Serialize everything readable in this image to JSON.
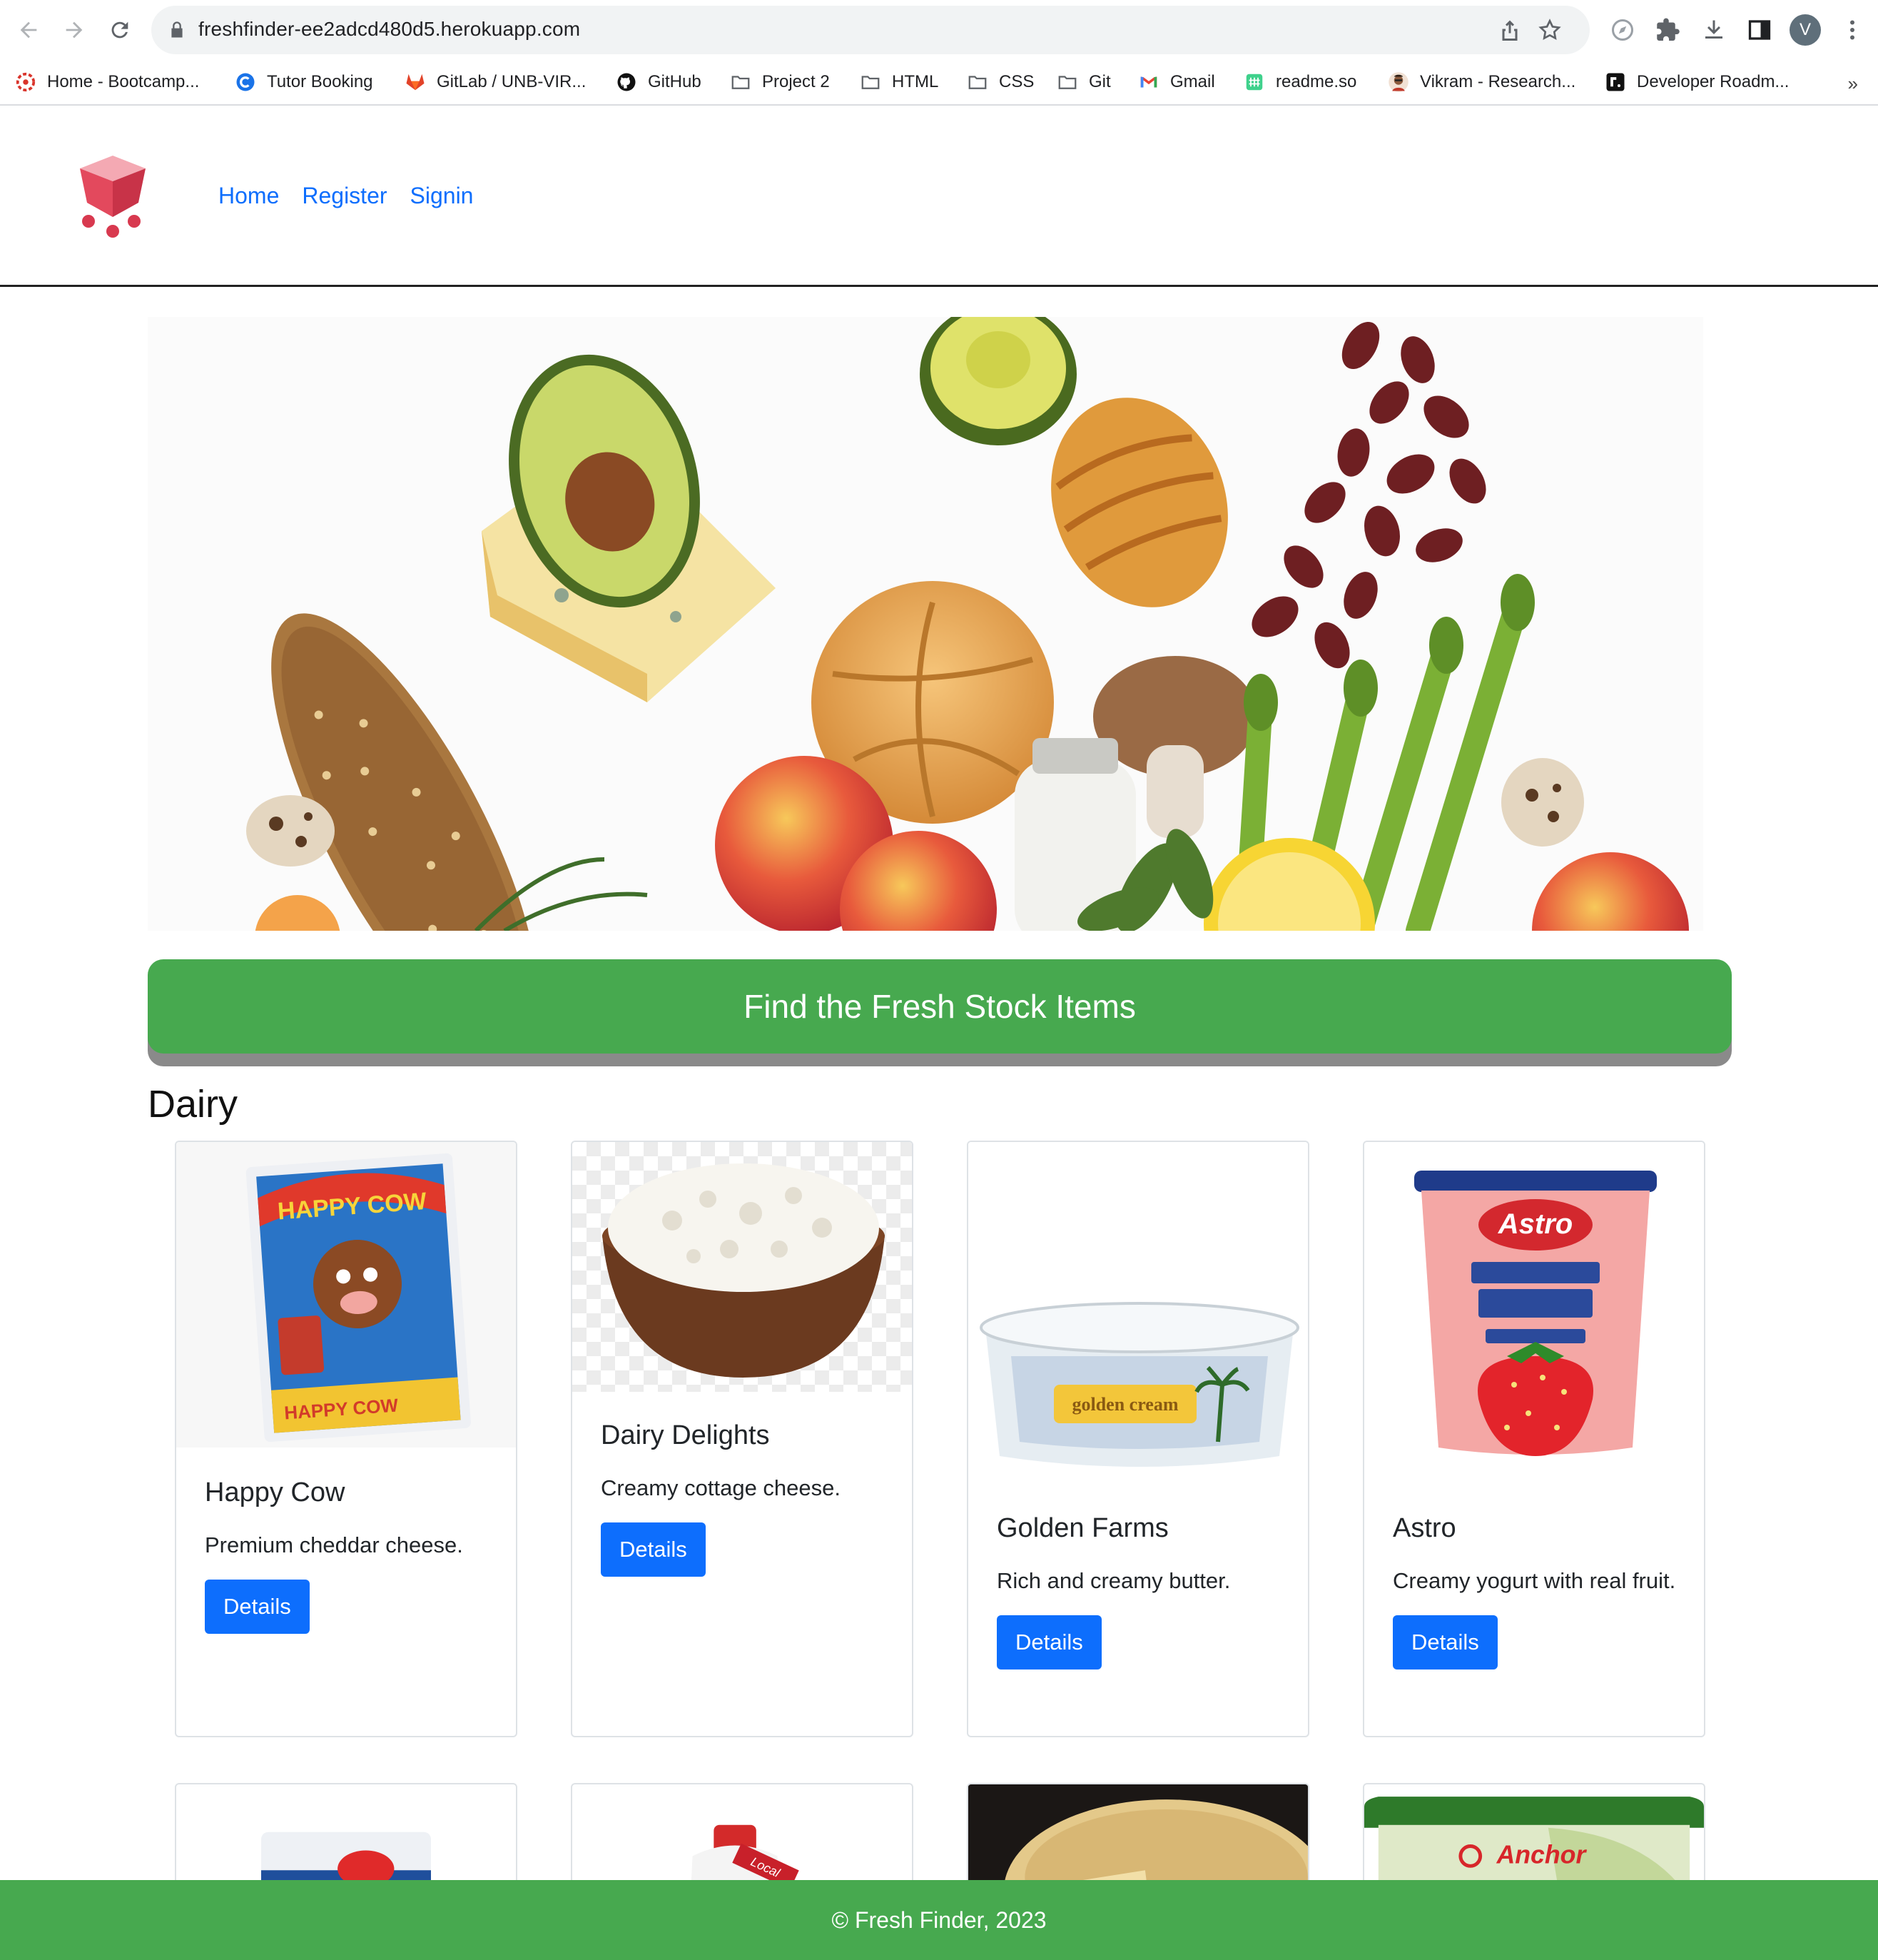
{
  "browser": {
    "url": "freshfinder-ee2adcd480d5.herokuapp.com",
    "profile_initial": "V",
    "bookmarks": [
      {
        "label": "Home - Bootcamp...",
        "icon": "bootcamp-logo-icon"
      },
      {
        "label": "Tutor Booking",
        "icon": "tutor-logo-icon"
      },
      {
        "label": "GitLab / UNB-VIR...",
        "icon": "gitlab-icon"
      },
      {
        "label": "GitHub",
        "icon": "github-icon"
      },
      {
        "label": "Project 2",
        "icon": "folder-icon"
      },
      {
        "label": "HTML",
        "icon": "folder-icon"
      },
      {
        "label": "CSS",
        "icon": "folder-icon"
      },
      {
        "label": "Git",
        "icon": "folder-icon"
      },
      {
        "label": "Gmail",
        "icon": "gmail-icon"
      },
      {
        "label": "readme.so",
        "icon": "readme-icon"
      },
      {
        "label": "Vikram - Research...",
        "icon": "profile-photo-icon"
      },
      {
        "label": "Developer Roadm...",
        "icon": "roadmap-icon"
      }
    ],
    "more_label": "»"
  },
  "site": {
    "nav": [
      "Home",
      "Register",
      "Signin"
    ],
    "banner": "Find the Fresh Stock Items",
    "section_title": "Dairy",
    "footer": "© Fresh Finder, 2023"
  },
  "products": [
    {
      "title": "Happy Cow",
      "text": "Premium cheddar cheese.",
      "button": "Details",
      "image_label": "HAPPY COW"
    },
    {
      "title": "Dairy Delights",
      "text": "Creamy cottage cheese.",
      "button": "Details"
    },
    {
      "title": "Golden Farms",
      "text": "Rich and creamy butter.",
      "button": "Details",
      "image_label": "golden cream"
    },
    {
      "title": "Astro",
      "text": "Creamy yogurt with real fruit.",
      "button": "Details",
      "image_label": "Astro"
    }
  ],
  "products_row2": [
    {
      "image_label": ""
    },
    {
      "image_label": "Local"
    },
    {
      "image_label": ""
    },
    {
      "image_label": "Anchor"
    }
  ],
  "carousel": {
    "slides": 3,
    "active": 0
  },
  "colors": {
    "brand_green": "#47a94f",
    "link_blue": "#0d6efd",
    "button_blue": "#0d6efd"
  }
}
